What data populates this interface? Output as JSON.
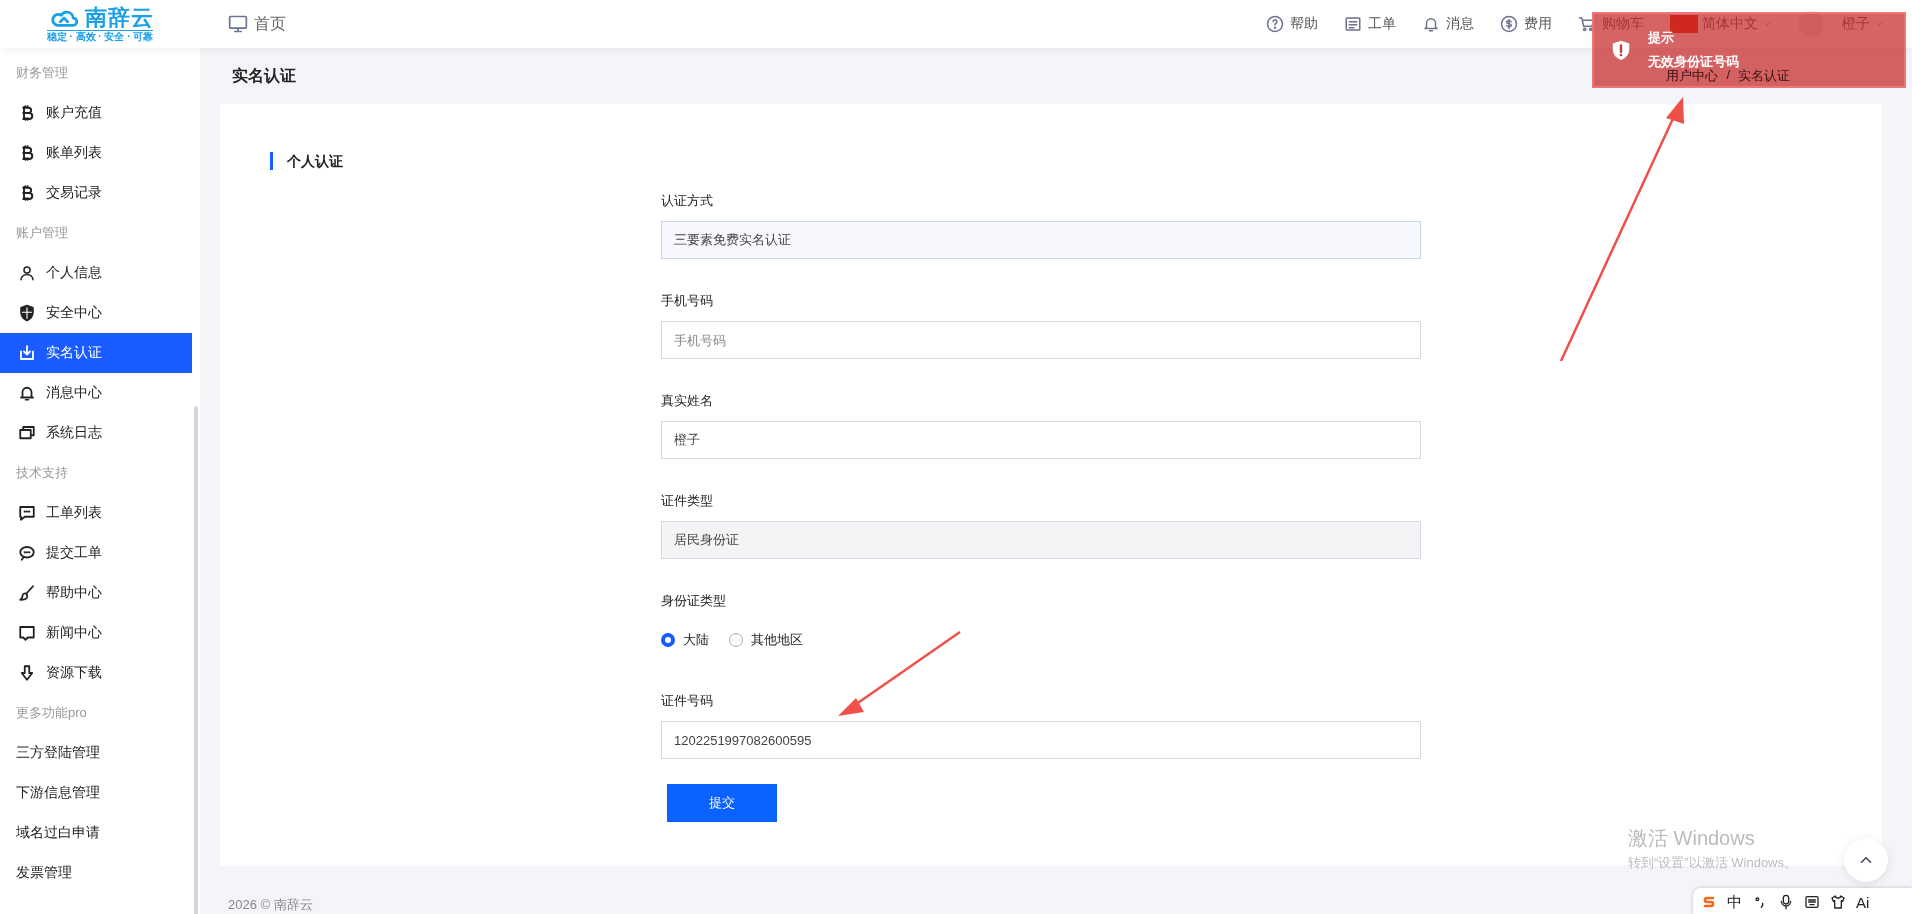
{
  "header": {
    "logo": {
      "name": "南辞云",
      "tagline": "稳定 · 高效 · 安全 · 可靠"
    },
    "home": "首页",
    "nav": [
      {
        "label": "帮助"
      },
      {
        "label": "工单"
      },
      {
        "label": "消息"
      },
      {
        "label": "费用"
      },
      {
        "label": "购物车"
      }
    ],
    "language": "简体中文",
    "user": "橙子"
  },
  "sidebar": {
    "groups": [
      {
        "title": "财务管理",
        "items": [
          {
            "label": "账户充值",
            "kind": "icon",
            "selected": false
          },
          {
            "label": "账单列表",
            "kind": "icon",
            "selected": false
          },
          {
            "label": "交易记录",
            "kind": "icon",
            "selected": false
          }
        ]
      },
      {
        "title": "账户管理",
        "items": [
          {
            "label": "个人信息",
            "kind": "icon",
            "selected": false
          },
          {
            "label": "安全中心",
            "kind": "icon",
            "selected": false
          },
          {
            "label": "实名认证",
            "kind": "icon",
            "selected": true
          },
          {
            "label": "消息中心",
            "kind": "icon",
            "selected": false
          },
          {
            "label": "系统日志",
            "kind": "icon",
            "selected": false
          }
        ]
      },
      {
        "title": "技术支持",
        "items": [
          {
            "label": "工单列表",
            "kind": "icon",
            "selected": false
          },
          {
            "label": "提交工单",
            "kind": "icon",
            "selected": false
          },
          {
            "label": "帮助中心",
            "kind": "icon",
            "selected": false
          },
          {
            "label": "新闻中心",
            "kind": "icon",
            "selected": false
          },
          {
            "label": "资源下载",
            "kind": "icon",
            "selected": false
          }
        ]
      },
      {
        "title": "更多功能pro",
        "items": [
          {
            "label": "三方登陆管理",
            "kind": "plain",
            "selected": false
          },
          {
            "label": "下游信息管理",
            "kind": "plain",
            "selected": false
          },
          {
            "label": "域名过白申请",
            "kind": "plain",
            "selected": false
          },
          {
            "label": "发票管理",
            "kind": "plain",
            "selected": false
          }
        ]
      }
    ]
  },
  "page": {
    "title": "实名认证",
    "breadcrumb": [
      "用户中心",
      "/",
      "实名认证"
    ]
  },
  "form": {
    "section_title": "个人认证",
    "fields": [
      {
        "kind": "input",
        "label": "认证方式",
        "value": "三要素免费实名认证",
        "highlighted": true,
        "disabled": false
      },
      {
        "kind": "input",
        "label": "手机号码",
        "placeholder": "手机号码",
        "highlighted": false,
        "disabled": false
      },
      {
        "kind": "input",
        "label": "真实姓名",
        "value": "橙子",
        "highlighted": false,
        "disabled": false
      },
      {
        "kind": "input",
        "label": "证件类型",
        "value": "居民身份证",
        "highlighted": false,
        "disabled": true
      },
      {
        "kind": "radio",
        "label": "身份证类型",
        "options": [
          {
            "label": "大陆",
            "selected": true
          },
          {
            "label": "其他地区",
            "selected": false
          }
        ]
      },
      {
        "kind": "input",
        "label": "证件号码",
        "value": "1202251997082600595",
        "highlighted": false,
        "disabled": false
      }
    ],
    "submit": "提交"
  },
  "footer": "2026 © 南辞云",
  "toast": {
    "title": "提示",
    "message": "无效身份证号码"
  },
  "watermark": {
    "title": "激活 Windows",
    "subtitle": "转到“设置”以激活 Windows。"
  },
  "ime": {
    "mode": "中",
    "ai": "Ai"
  }
}
